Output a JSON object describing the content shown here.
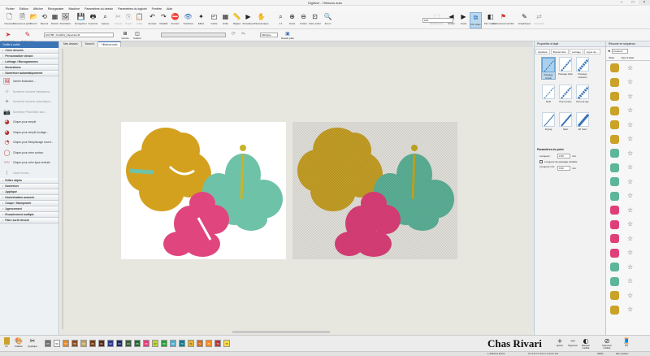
{
  "window": {
    "title": "Digitizer - Hibiscus auto"
  },
  "menu": [
    "Fichier",
    "Edition",
    "Afficher",
    "Réorganiser",
    "Machine",
    "Paramètres du dessin",
    "Paramètres du logiciel",
    "Fenêtre",
    "Aide"
  ],
  "toolbar": [
    {
      "label": "Nouveau",
      "icon": "new-file-icon"
    },
    {
      "label": "Nouveau à partir",
      "icon": "new-from-icon"
    },
    {
      "label": "Ouvrir",
      "icon": "open-icon"
    },
    {
      "label": "Récent",
      "icon": "recent-icon"
    },
    {
      "label": "Dessin",
      "icon": "design-icon"
    },
    {
      "label": "Illustration",
      "icon": "illustration-icon"
    },
    {
      "label": "Enregistrer",
      "icon": "save-icon"
    },
    {
      "label": "Imprimer",
      "icon": "print-icon"
    },
    {
      "label": "Aperçu",
      "icon": "preview-icon"
    },
    {
      "label": "Couper",
      "icon": "cut-icon",
      "disabled": true
    },
    {
      "label": "Copier",
      "icon": "copy-icon",
      "disabled": true
    },
    {
      "label": "Coller",
      "icon": "paste-icon",
      "disabled": true
    },
    {
      "label": "Annuler",
      "icon": "undo-icon"
    },
    {
      "label": "Rétablir",
      "icon": "redo-icon"
    },
    {
      "label": "Annuler",
      "icon": "cancel-icon"
    },
    {
      "label": "TrueView",
      "icon": "trueview-icon"
    },
    {
      "label": "Effets",
      "icon": "effects-icon"
    },
    {
      "label": "Cadre",
      "icon": "hoop-icon"
    },
    {
      "label": "Grille",
      "icon": "grid-icon"
    },
    {
      "label": "Règles",
      "icon": "rulers-icon"
    },
    {
      "label": "Simulateur",
      "icon": "simulator-icon"
    },
    {
      "label": "Panoramique",
      "icon": "pan-icon"
    },
    {
      "label": "1:1",
      "icon": "zoom-1to1-icon"
    },
    {
      "label": "Avant",
      "icon": "zoom-in-icon"
    },
    {
      "label": "Arrière",
      "icon": "zoom-out-icon"
    },
    {
      "label": "Faire coller",
      "icon": "fit-icon"
    },
    {
      "label": "Zoom",
      "icon": "zoom-icon"
    },
    {
      "label": "Sélectionner",
      "icon": "select-icon",
      "disabled": true
    },
    {
      "label": "Arrière",
      "icon": "back-icon"
    },
    {
      "label": "Avant",
      "icon": "forward-icon"
    },
    {
      "label": "Par objet",
      "icon": "by-object-icon",
      "selected": true
    },
    {
      "label": "Par couleur",
      "icon": "by-color-icon"
    },
    {
      "label": "Commencement/Fin",
      "icon": "start-end-icon"
    },
    {
      "label": "Graphiques",
      "icon": "graphics-icon"
    },
    {
      "label": "Convertir",
      "icon": "convert-icon",
      "disabled": true
    }
  ],
  "zoom_value": "100",
  "toolbar2": {
    "select_label": "Sélectionner",
    "reshape_label": "Refaçonner",
    "design_field": "HIC788 : Dmd001_eSpecial.ef3",
    "units": "Métrique",
    "rotate_label": "Rotation",
    "mirror_label": "Miroir",
    "border_label": "Bordure",
    "extra_label": "Entrée",
    "center_label": "Centre",
    "hide_label": "Cacher",
    "design_plan_label": "Dessin plan"
  },
  "left_panel": {
    "title": "Outils à outils",
    "sections_top": [
      "Créer dessins",
      "Personnaliser dessin",
      "Lettrage / Monogrammes",
      "Illustrations",
      "Numériser automatiquement"
    ],
    "items": [
      {
        "label": "Insérer illustration...",
        "icon": "insert-image-icon",
        "disabled": false
      },
      {
        "label": "Numériser broderie instantanée...",
        "icon": "instant-icon",
        "disabled": true
      },
      {
        "label": "Numériser broderie automatique...",
        "icon": "auto-digitize-icon",
        "disabled": true
      },
      {
        "label": "Numériser PhotoStitch auto...",
        "icon": "photostitch-icon",
        "disabled": true
      },
      {
        "label": "Cliquer-pour-remplir",
        "icon": "click-fill-icon",
        "disabled": false
      },
      {
        "label": "Cliquer-pour-remplir brodage...",
        "icon": "click-fill-stitch-icon",
        "disabled": false
      },
      {
        "label": "Cliquer-pour-Remplissage ouvert...",
        "icon": "click-open-fill-icon",
        "disabled": false
      },
      {
        "label": "Cliquer-pour-créer contour",
        "icon": "click-outline-icon",
        "disabled": false
      },
      {
        "label": "Cliquer-pour-créer ligne centrale",
        "icon": "click-centerline-icon",
        "disabled": false
      },
      {
        "label": "Lisser formes...",
        "icon": "smooth-icon",
        "disabled": true
      }
    ],
    "sections_bottom": [
      "Editer objets",
      "Numériser",
      "Appliqué",
      "Numérisation avancée",
      "Coupe / Stumpwork",
      "Agencement",
      "Encadrement multiple",
      "Faire sortir dessin"
    ]
  },
  "tabs": [
    {
      "label": "Mes dessins",
      "active": false
    },
    {
      "label": "Dessin1",
      "active": false
    },
    {
      "label": "Hibiscus auto",
      "active": true
    }
  ],
  "right_panel": {
    "title": "Propriétés d'objet",
    "tabs": [
      "Appliqué",
      "Boutonnière",
      "Lettrage",
      "Ligne de..."
    ],
    "stitches": [
      {
        "label": "Passage simple",
        "selected": true
      },
      {
        "label": "Passage triple",
        "selected": false
      },
      {
        "label": "Passage sculpture",
        "selected": false
      },
      {
        "label": "Motif",
        "selected": false
      },
      {
        "label": "Point arrière",
        "selected": false
      },
      {
        "label": "Point de tige",
        "selected": false
      },
      {
        "label": "Zigzag",
        "selected": false
      },
      {
        "label": "Satin",
        "selected": false
      },
      {
        "label": "3D Satin",
        "selected": false
      }
    ],
    "params_title": "Paramètres de point",
    "length_label": "Longueur :",
    "length_value": "2.00",
    "length_unit": "mm",
    "variable_label": "Longueur de passage variable",
    "min_label": "Longueur min. :",
    "min_value": "0.90",
    "min_unit": "mm"
  },
  "seq_panel": {
    "title": "Résumé en séquence",
    "btn_label": "Couleurs",
    "col1": "Objet",
    "col2": "Type d'objet",
    "rows": [
      "#c9a227",
      "#c9a227",
      "#c9a227",
      "#c9a227",
      "#c9a227",
      "#c9a227",
      "#5db59a",
      "#5db59a",
      "#5db59a",
      "#5db59a",
      "#e0407a",
      "#e0407a",
      "#e0407a",
      "#e0407a",
      "#5db59a",
      "#5db59a",
      "#c9a227",
      "#c9a227"
    ]
  },
  "palette": {
    "tools": [
      "Fil",
      "Palette",
      "Appliqué"
    ],
    "colors": [
      "#6f6f6f",
      "#fafafa",
      "#e78a2a",
      "#8a4b1e",
      "#c2a35a",
      "#6f3d1c",
      "#5a2b12",
      "#2f3a8a",
      "#1b2a6b",
      "#3b5b3a",
      "#1f6d2f",
      "#e0407a",
      "#c1d52b",
      "#2a9b3a",
      "#4ab0d0",
      "#0e7d8c",
      "#e6b12a",
      "#d96c1e",
      "#ff8c1a",
      "#b53a3a",
      "#ffd84a"
    ],
    "numbers": [
      "55",
      "56",
      "57",
      "58",
      "59",
      "60",
      "61",
      "62",
      "63",
      "64",
      "65",
      "66",
      "67",
      "68",
      "69",
      "70",
      "71",
      "72",
      "73",
      "74",
      "75"
    ],
    "actions": [
      "Ajouter",
      "Supprimer",
      "Masquer inutilisé",
      "Supprimer inutilisé",
      "Fils"
    ]
  },
  "watermark": "Chas Rivari",
  "status": {
    "left": "L 236.8 H 113.9",
    "coords": "X= 0.0 Y= 0.0 L= 0.0 A= 0.0",
    "zoom": "226%",
    "mode": "Par couleur"
  }
}
